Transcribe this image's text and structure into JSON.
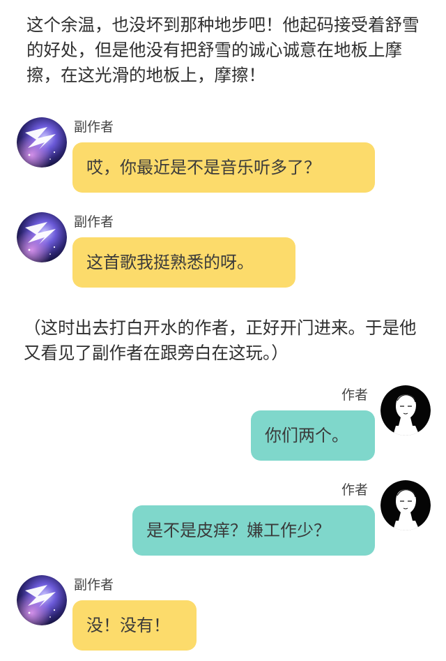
{
  "narration": {
    "top_text": "这个余温，也没坏到那种地步吧！他起码接受着舒雪的好处，但是他没有把舒雪的诚心诚意在地板上摩擦，在这光滑的地板上，摩擦！",
    "middle_text": "（这时出去打白开水的作者，正好开门进来。于是他又看见了副作者在跟旁白在这玩。）"
  },
  "messages": [
    {
      "side": "left",
      "sender": "副作者",
      "text": "哎，你最近是不是音乐听多了？",
      "avatar": "galaxy-wing-avatar"
    },
    {
      "side": "left",
      "sender": "副作者",
      "text": "这首歌我挺熟悉的呀。",
      "avatar": "galaxy-wing-avatar"
    },
    {
      "side": "right",
      "sender": "作者",
      "text": "你们两个。",
      "avatar": "sketch-boy-avatar"
    },
    {
      "side": "right",
      "sender": "作者",
      "text": "是不是皮痒？嫌工作少？",
      "avatar": "sketch-boy-avatar"
    },
    {
      "side": "left",
      "sender": "副作者",
      "text": "没！没有！",
      "avatar": "galaxy-wing-avatar"
    }
  ],
  "colors": {
    "left_bubble": "#fcdb6b",
    "right_bubble": "#7fd7cb",
    "background": "#ffffff"
  }
}
